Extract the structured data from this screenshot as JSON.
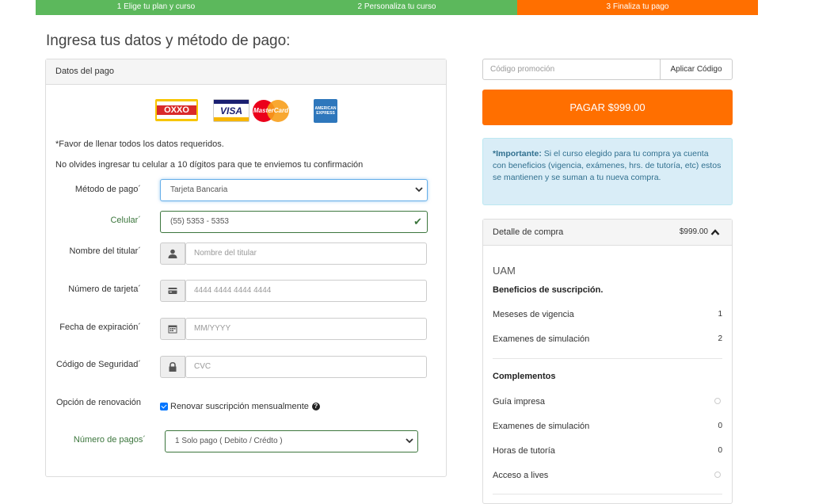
{
  "steps": [
    {
      "label": "1  Elige tu plan y curso",
      "state": "done"
    },
    {
      "label": "2  Personaliza tu curso",
      "state": "done"
    },
    {
      "label": "3  Finaliza tu pago",
      "state": "current"
    }
  ],
  "colors": {
    "success": "#5cb85c",
    "accent": "#ff6f00",
    "info_bg": "#d9edf7",
    "info_text": "#31708f"
  },
  "page_title": "Ingresa tus datos y método de pago:",
  "payment_panel": {
    "heading": "Datos del pago",
    "card_logos": {
      "oxxo": "OXXO",
      "visa": "VISA",
      "mastercard": "MasterCard",
      "amex": "AMERICAN EXPRESS"
    },
    "required_note": "*Favor de llenar todos los datos requeridos.",
    "phone_note": "No olvides ingresar tu celular a 10 dígitos para que te enviemos tu confirmación",
    "metodo_label": "Método de pago´",
    "metodo_value": "Tarjeta Bancaria",
    "celular_label": "Celular´",
    "celular_value": "(55) 5353 - 5353",
    "titular_label": "Nombre del titular´",
    "titular_placeholder": "Nombre del titular",
    "tarjeta_label": "Número de tarjeta´",
    "tarjeta_placeholder": "4444 4444 4444 4444",
    "fecha_label": "Fecha de expiración´",
    "fecha_placeholder": "MM/YYYY",
    "codigo_label": "Código de Seguridad´",
    "codigo_placeholder": "CVC",
    "renovacion_label": "Opción de renovación",
    "renovacion_text": "Renovar suscripción mensualmente",
    "pagos_label": "Número de pagos´",
    "pagos_value": "1 Solo pago ( Debito / Crédto )"
  },
  "promo": {
    "placeholder": "Código promoción",
    "button": "Aplicar Código"
  },
  "pay_button": "PAGAR $999.00",
  "alert": {
    "strong": "*Importante:",
    "text": " Si el curso elegido para tu compra ya cuenta con beneficios (vigencia, exámenes, hrs. de tutoría, etc) estos se mantienen y se suman a tu nueva compra."
  },
  "detail": {
    "heading": "Detalle de compra",
    "price": "$999.00",
    "course": "UAM",
    "benefits_title": "Beneficios de suscripción.",
    "benefits": [
      {
        "label": "Meseses de vigencia",
        "value": "1"
      },
      {
        "label": "Examenes de simulación",
        "value": "2"
      }
    ],
    "complements_title": "Complementos",
    "complements": [
      {
        "label": "Guía impresa",
        "value": ""
      },
      {
        "label": "Examenes de simulación",
        "value": "0"
      },
      {
        "label": "Horas de tutoría",
        "value": "0"
      },
      {
        "label": "Acceso a lives",
        "value": ""
      }
    ]
  }
}
